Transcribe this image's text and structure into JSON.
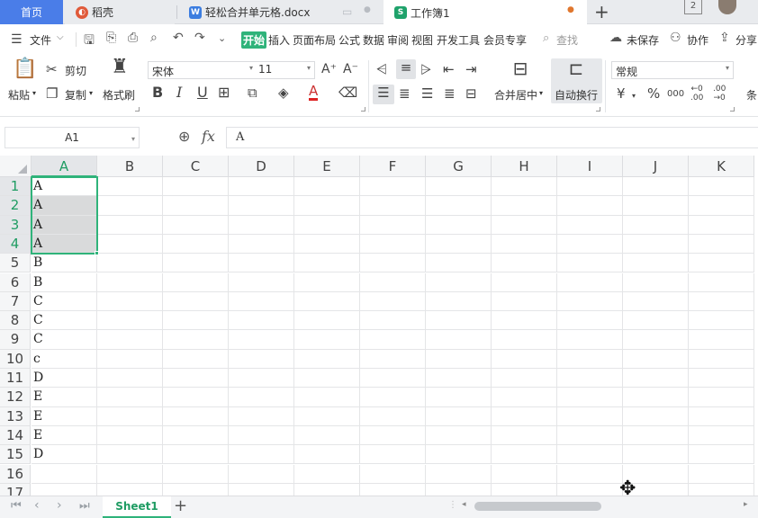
{
  "tabs": {
    "home": "首页",
    "daoke": "稻壳",
    "doc": "轻松合并单元格.docx",
    "book": "工作簿1",
    "badge": "2"
  },
  "menu": {
    "file": "文件",
    "items": [
      "开始",
      "插入",
      "页面布局",
      "公式",
      "数据",
      "审阅",
      "视图",
      "开发工具",
      "会员专享"
    ],
    "search": "查找",
    "unsaved": "未保存",
    "collab": "协作",
    "share": "分享"
  },
  "ribbon": {
    "paste": "粘贴",
    "cut": "剪切",
    "copy": "复制",
    "format_painter": "格式刷",
    "font_name": "宋体",
    "font_size": "11",
    "merge_center": "合并居中",
    "wrap_text": "自动换行",
    "number_format": "常规",
    "cond_partial": "条"
  },
  "formula_bar": {
    "name_box": "A1",
    "fx": "fx",
    "content": "A"
  },
  "grid": {
    "columns": [
      "A",
      "B",
      "C",
      "D",
      "E",
      "F",
      "G",
      "H",
      "I",
      "J",
      "K"
    ],
    "rows": [
      "1",
      "2",
      "3",
      "4",
      "5",
      "6",
      "7",
      "8",
      "9",
      "10",
      "11",
      "12",
      "13",
      "14",
      "15",
      "16",
      "17"
    ],
    "col_a_values": [
      "A",
      "A",
      "A",
      "A",
      "B",
      "B",
      "C",
      "C",
      "C",
      "c",
      "D",
      "E",
      "E",
      "E",
      "D",
      "",
      ""
    ]
  },
  "sheetbar": {
    "sheet_name": "Sheet1",
    "add": "+"
  },
  "colors": {
    "accent_green": "#2fb37a",
    "selection_border": "#2fb37a",
    "home_tab": "#4a7de8"
  }
}
